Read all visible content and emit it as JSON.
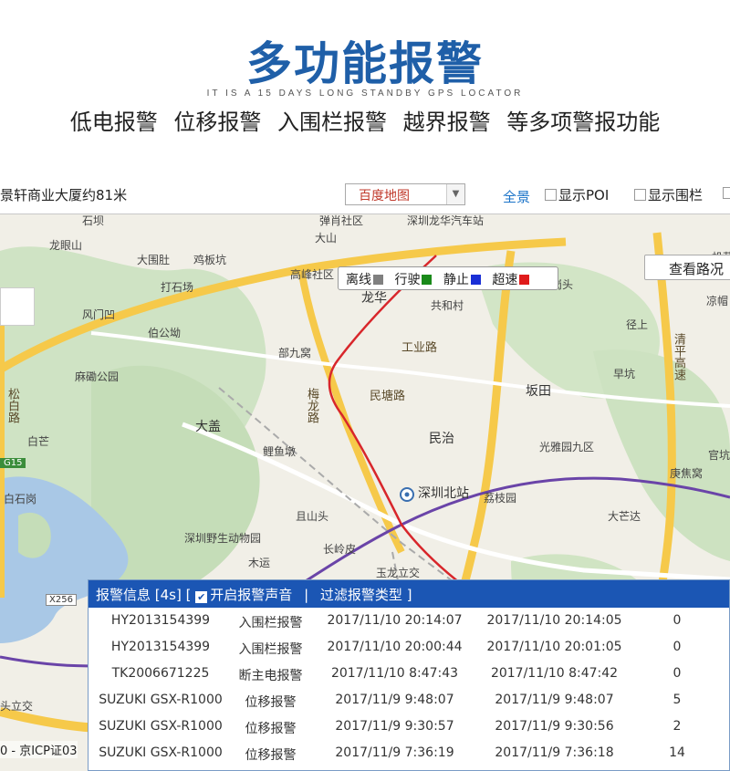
{
  "header": {
    "title": "多功能报警",
    "subtitle": "IT IS A 15 DAYS LONG STANDBY GPS LOCATOR",
    "features": "低电报警  位移报警   入围栏报警  越界报警  等多项警报功能"
  },
  "toolbar": {
    "address": "景轩商业大厦约81米",
    "map_select": "百度地图",
    "full_view": "全景",
    "show_poi": "显示POI",
    "show_fence": "显示围栏"
  },
  "legend": {
    "items": [
      {
        "label": "离线",
        "color": "#808080"
      },
      {
        "label": "行驶",
        "color": "#1a8a1a"
      },
      {
        "label": "静止",
        "color": "#1a2fd6"
      },
      {
        "label": "超速",
        "color": "#e01b1b"
      }
    ]
  },
  "traffic_button": "查看路况",
  "map_labels": {
    "l1": "龙眼山",
    "l2": "大围肚",
    "l3": "鸡板坑",
    "l4": "打石场",
    "l5": "风门凹",
    "l6": "伯公坳",
    "l7": "高峰社区",
    "l8": "龙华",
    "l9": "共和村",
    "l10": "工业路",
    "l11": "部九窝",
    "l12": "麻磡公园",
    "l13": "民塘路",
    "l14": "坂田",
    "l15": "大盖",
    "l16": "鲤鱼墩",
    "l17": "民治",
    "l18": "光雅园九区",
    "l19": "白石岗",
    "l20": "深圳北站",
    "l21": "荔枝园",
    "l22": "且山头",
    "l23": "大芒达",
    "l24": "深圳野生动物园",
    "l25": "长岭皮",
    "l26": "木运",
    "l27": "玉龙立交",
    "l28": "梅龙路",
    "l29": "松白路",
    "l30": "白芒",
    "l31": "岗头",
    "l32": "径上",
    "l33": "早坑",
    "l34": "清平高速",
    "l35": "庚焦窝",
    "l36": "官坑",
    "l37": "凉帽",
    "l38": "机荷",
    "l39": "深圳龙华汽车站",
    "l40": "大山",
    "l41": "头立交",
    "l42": "G15",
    "l43": "X256",
    "l44": "石坝",
    "l45": "弹肖社区"
  },
  "icp": "0 - 京ICP证03",
  "alarm_panel": {
    "title": "报警信息 [4s]",
    "sound_label": "开启报警声音",
    "separator": "|",
    "filter_label": "过滤报警类型 ]",
    "open_bracket": "[",
    "rows": [
      {
        "id": "HY2013154399",
        "type": "入围栏报警",
        "t1": "2017/11/10 20:14:07",
        "t2": "2017/11/10 20:14:05",
        "n": "0"
      },
      {
        "id": "HY2013154399",
        "type": "入围栏报警",
        "t1": "2017/11/10 20:00:44",
        "t2": "2017/11/10 20:01:05",
        "n": "0"
      },
      {
        "id": "TK2006671225",
        "type": "断主电报警",
        "t1": "2017/11/10 8:47:43",
        "t2": "2017/11/10 8:47:42",
        "n": "0"
      },
      {
        "id": "SUZUKI GSX-R1000",
        "type": "位移报警",
        "t1": "2017/11/9 9:48:07",
        "t2": "2017/11/9 9:48:07",
        "n": "5"
      },
      {
        "id": "SUZUKI GSX-R1000",
        "type": "位移报警",
        "t1": "2017/11/9 9:30:57",
        "t2": "2017/11/9 9:30:56",
        "n": "2"
      },
      {
        "id": "SUZUKI GSX-R1000",
        "type": "位移报警",
        "t1": "2017/11/9 7:36:19",
        "t2": "2017/11/9 7:36:18",
        "n": "14"
      }
    ]
  }
}
